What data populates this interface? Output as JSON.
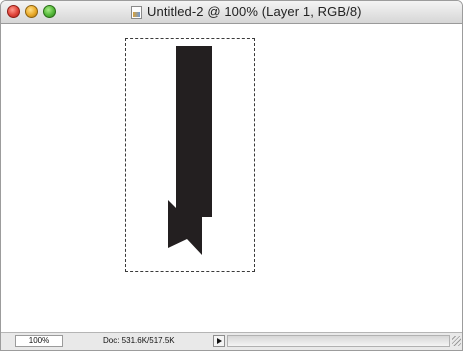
{
  "window": {
    "title": "Untitled-2 @ 100% (Layer 1, RGB/8)",
    "buttons": [
      "close",
      "minimize",
      "zoom"
    ],
    "document_icon": "photoshop-document-icon"
  },
  "canvas": {
    "selection": "marquee-selection",
    "shape": "ribbon-bookmark-shape",
    "shape_color": "#231f20"
  },
  "status": {
    "zoom": "100%",
    "doc_size": "Doc: 531.6K/517.5K"
  }
}
